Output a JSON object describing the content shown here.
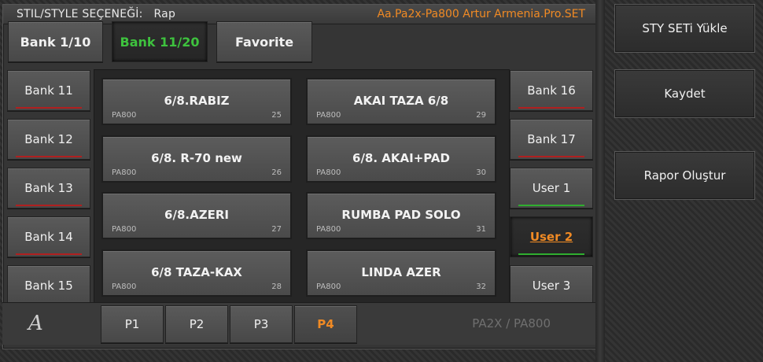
{
  "header": {
    "label": "STIL/STYLE SEÇENEĞİ:",
    "style_value": "Rap",
    "set_name": "Aa.Pa2x-Pa800 Artur Armenia.Pro.SET"
  },
  "bank_range_tabs": [
    {
      "label": "Bank 1/10",
      "active": false
    },
    {
      "label": "Bank 11/20",
      "active": true
    },
    {
      "label": "Favorite",
      "active": false
    }
  ],
  "left_banks": [
    {
      "label": "Bank 11"
    },
    {
      "label": "Bank 12"
    },
    {
      "label": "Bank 13"
    },
    {
      "label": "Bank 14"
    },
    {
      "label": "Bank 15"
    }
  ],
  "right_banks": [
    {
      "label": "Bank 16",
      "indicator": "red"
    },
    {
      "label": "Bank 17",
      "indicator": "red"
    },
    {
      "label": "User 1",
      "indicator": "green"
    },
    {
      "label": "User 2",
      "indicator": "green",
      "active": true
    },
    {
      "label": "User 3",
      "indicator": "green"
    }
  ],
  "styles": [
    {
      "name": "6/8.RABIZ",
      "device": "PA800",
      "number": "25"
    },
    {
      "name": "AKAI TAZA 6/8",
      "device": "PA800",
      "number": "29"
    },
    {
      "name": "6/8. R-70 new",
      "device": "PA800",
      "number": "26"
    },
    {
      "name": "6/8. AKAI+PAD",
      "device": "PA800",
      "number": "30"
    },
    {
      "name": "6/8.AZERI",
      "device": "PA800",
      "number": "27"
    },
    {
      "name": "RUMBA PAD SOLO",
      "device": "PA800",
      "number": "31"
    },
    {
      "name": "6/8 TAZA-KAX",
      "device": "PA800",
      "number": "28"
    },
    {
      "name": "LINDA AZER",
      "device": "PA800",
      "number": "32"
    }
  ],
  "pages": [
    {
      "label": "P1"
    },
    {
      "label": "P2"
    },
    {
      "label": "P3"
    },
    {
      "label": "P4",
      "active": true
    }
  ],
  "logo_glyph": "A",
  "model_label": "PA2X / PA800",
  "actions": {
    "load": "STY  SETi  Yükle",
    "save": "Kaydet",
    "report": "Rapor Oluştur"
  },
  "colors": {
    "accent_orange": "#f08a24",
    "active_green": "#3ec23e",
    "indicator_red": "#b02020",
    "indicator_green": "#2fae2f"
  }
}
